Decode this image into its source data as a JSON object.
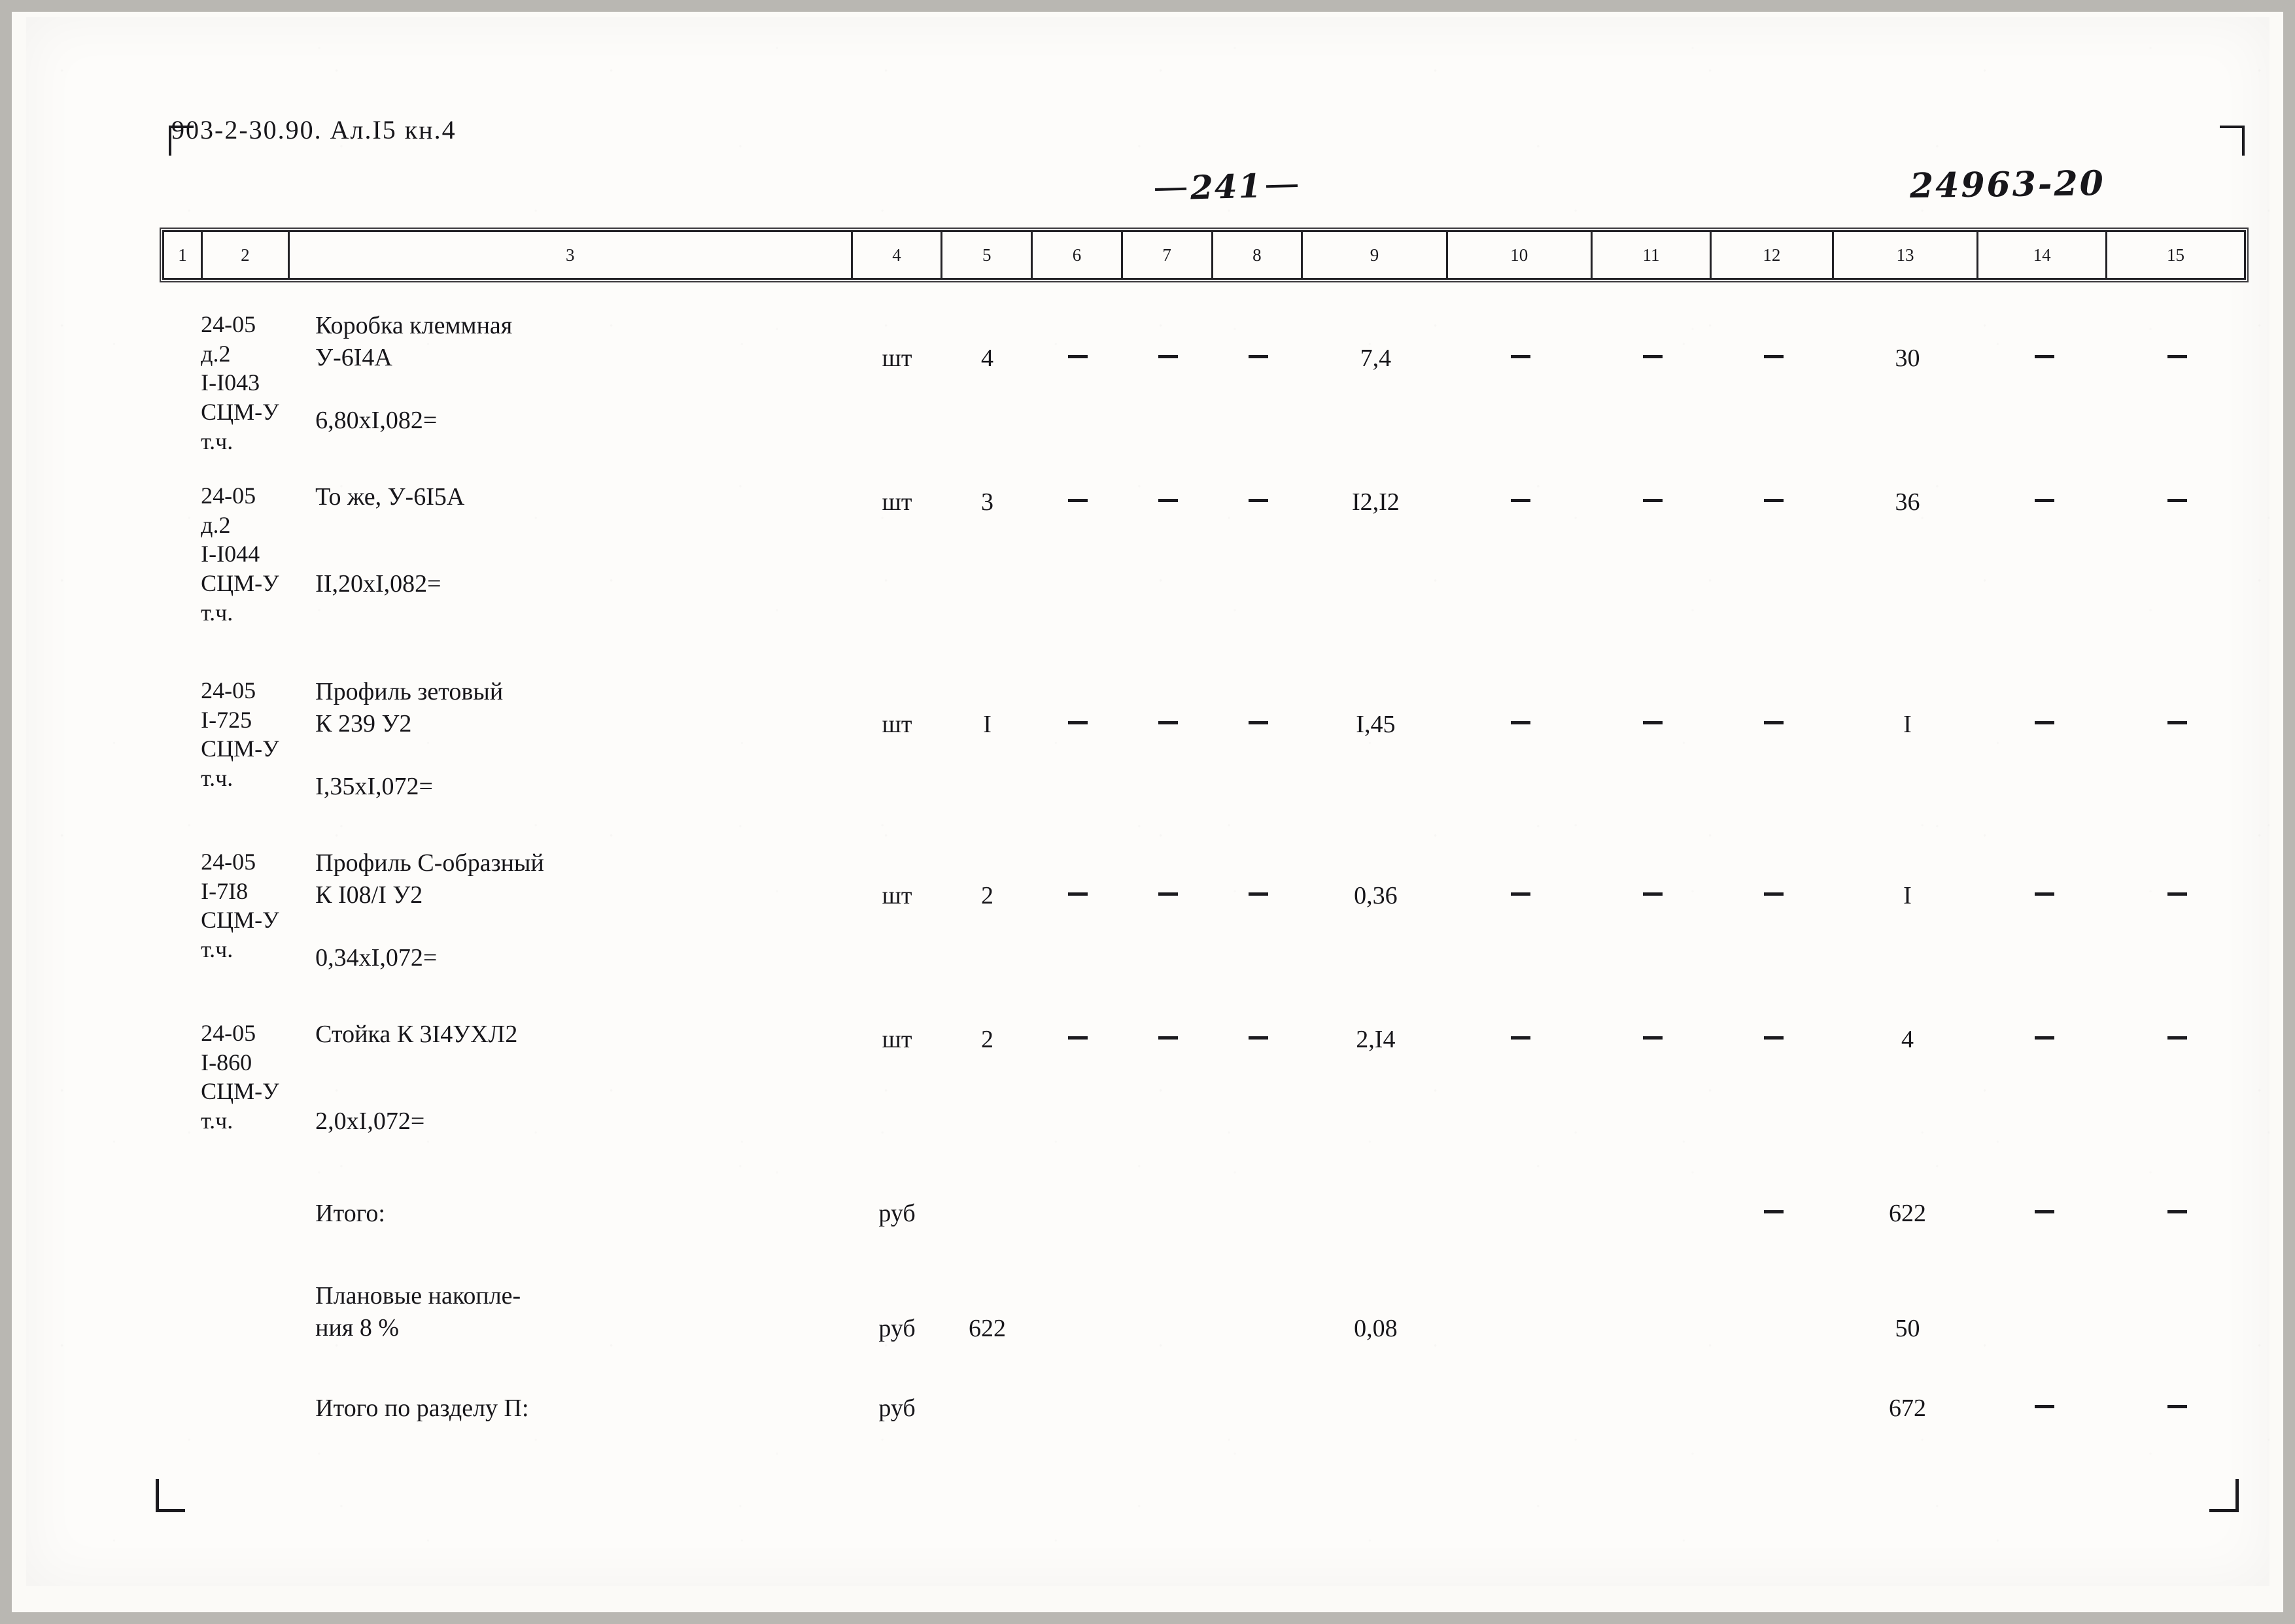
{
  "header": {
    "doc_ref": "903-2-30.90. Ал.I5 кн.4",
    "page_number": "241",
    "doc_code": "24963-20"
  },
  "table": {
    "column_headers": [
      "1",
      "2",
      "3",
      "4",
      "5",
      "6",
      "7",
      "8",
      "9",
      "10",
      "11",
      "12",
      "13",
      "14",
      "15"
    ],
    "dash_glyph": "—",
    "rows": [
      {
        "code_lines": [
          "24-05",
          "д.2",
          "I-I043",
          "СЦМ-У",
          "т.ч."
        ],
        "desc_lines": [
          "Коробка клеммная",
          "У-6I4А"
        ],
        "calc": "6,80хI,082=",
        "unit": "шт",
        "qty": "4",
        "c6": "—",
        "c7": "—",
        "c8": "—",
        "c9": "7,4",
        "c10": "—",
        "c11": "—",
        "c12": "—",
        "c13": "30",
        "c14": "—",
        "c15": "—"
      },
      {
        "code_lines": [
          "24-05",
          "д.2",
          "I-I044",
          "СЦМ-У",
          "т.ч."
        ],
        "desc_lines": [
          "То же, У-6I5А"
        ],
        "calc": "II,20хI,082=",
        "unit": "шт",
        "qty": "3",
        "c6": "—",
        "c7": "—",
        "c8": "—",
        "c9": "I2,I2",
        "c10": "—",
        "c11": "—",
        "c12": "—",
        "c13": "36",
        "c14": "—",
        "c15": "—"
      },
      {
        "code_lines": [
          "24-05",
          "I-725",
          "СЦМ-У",
          "т.ч."
        ],
        "desc_lines": [
          "Профиль зетовый",
          "К 239 У2"
        ],
        "calc": "I,35хI,072=",
        "unit": "шт",
        "qty": "I",
        "c6": "—",
        "c7": "—",
        "c8": "—",
        "c9": "I,45",
        "c10": "—",
        "c11": "—",
        "c12": "—",
        "c13": "I",
        "c14": "—",
        "c15": "—"
      },
      {
        "code_lines": [
          "24-05",
          "I-7I8",
          "СЦМ-У",
          "т.ч."
        ],
        "desc_lines": [
          "Профиль С-образный",
          "К I08/I У2"
        ],
        "calc": "0,34хI,072=",
        "unit": "шт",
        "qty": "2",
        "c6": "—",
        "c7": "—",
        "c8": "—",
        "c9": "0,36",
        "c10": "—",
        "c11": "—",
        "c12": "—",
        "c13": "I",
        "c14": "—",
        "c15": "—"
      },
      {
        "code_lines": [
          "24-05",
          "I-860",
          "СЦМ-У",
          "т.ч."
        ],
        "desc_lines": [
          "Стойка К 3I4УХЛ2"
        ],
        "calc": "2,0хI,072=",
        "unit": "шт",
        "qty": "2",
        "c6": "—",
        "c7": "—",
        "c8": "—",
        "c9": "2,I4",
        "c10": "—",
        "c11": "—",
        "c12": "—",
        "c13": "4",
        "c14": "—",
        "c15": "—"
      }
    ],
    "summary_rows": [
      {
        "label_lines": [
          "Итого:"
        ],
        "unit": "руб",
        "qty": "",
        "c9": "",
        "c12": "—",
        "c13": "622",
        "c14": "—",
        "c15": "—"
      },
      {
        "label_lines": [
          "Плановые накопле-",
          "ния 8 %"
        ],
        "unit": "руб",
        "qty": "622",
        "c9": "0,08",
        "c12": "",
        "c13": "50",
        "c14": "",
        "c15": ""
      },
      {
        "label_lines": [
          "Итого по разделу П:"
        ],
        "unit": "руб",
        "qty": "",
        "c9": "",
        "c12": "",
        "c13": "672",
        "c14": "—",
        "c15": "—"
      }
    ]
  }
}
